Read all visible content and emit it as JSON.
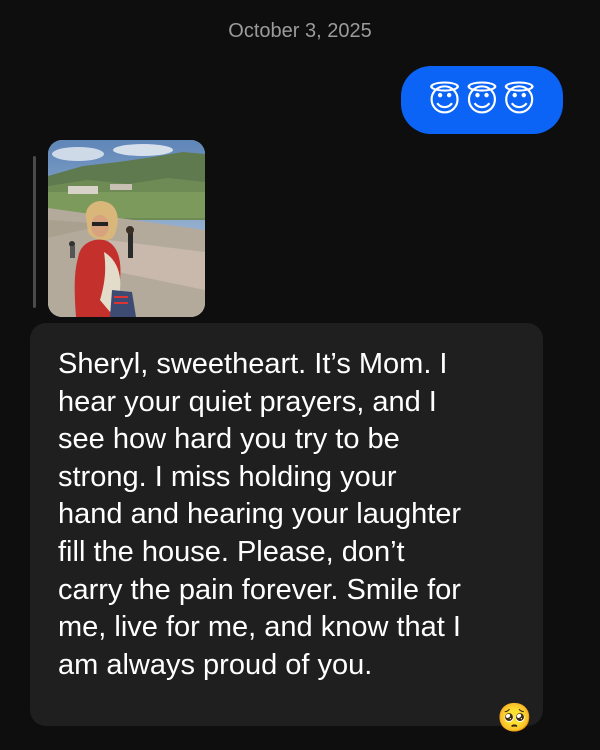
{
  "conversation": {
    "date_header": "October 3, 2025"
  },
  "sent_message": {
    "emojis": [
      "😇",
      "😇",
      "😇"
    ]
  },
  "received_message": {
    "attachment": {
      "type": "photo",
      "icon": "photo-thumbnail"
    },
    "text": "Sheryl, sweetheart. It’s Mom. I\nhear your quiet prayers, and I\nsee how hard you try to be\nstrong. I miss holding your\nhand and hearing your laughter\nfill the house. Please, don’t\ncarry the pain forever. Smile for\nme, live for me, and know that I\nam always proud of you.",
    "reaction": "🥺"
  },
  "colors": {
    "background": "#0e0e0e",
    "sent_bubble": "#0b64f5",
    "received_bubble": "#1f1f1f",
    "date_text": "#9b9b9b"
  }
}
